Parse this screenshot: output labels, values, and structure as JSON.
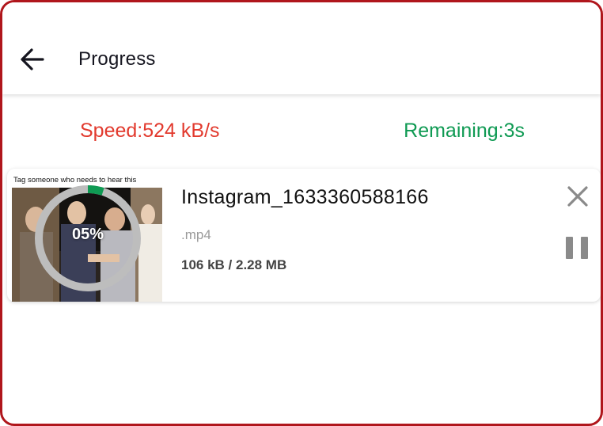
{
  "header": {
    "title": "Progress",
    "back_icon": "arrow-left-icon"
  },
  "stats": {
    "speed": "Speed:524 kB/s",
    "remaining": "Remaining:3s",
    "speed_color": "#e23a2e",
    "remaining_color": "#0f9a53"
  },
  "download": {
    "thumbnail_caption": "Tag someone who needs to hear this",
    "percent_label": "05%",
    "progress_fraction": 0.05,
    "filename": "Instagram_1633360588166",
    "extension": ".mp4",
    "size": "106 kB / 2.28 MB",
    "close_icon": "close-icon",
    "pause_icon": "pause-icon"
  },
  "colors": {
    "frame_border": "#b0161c",
    "progress_track": "#bdbdbd",
    "progress_fill": "#0f9a53"
  }
}
